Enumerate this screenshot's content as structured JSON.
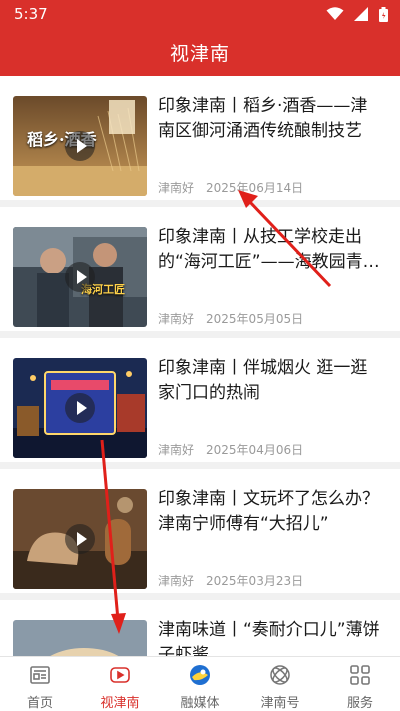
{
  "status": {
    "time": "5:37"
  },
  "header": {
    "title": "视津南"
  },
  "articles": [
    {
      "title": "印象津南丨稻乡·酒香——津南区御河涌酒传统酿制技艺",
      "source": "津南好",
      "date": "2025年06月14日",
      "thumb_caption": "稻乡·酒香"
    },
    {
      "title": "印象津南丨从技工学校走出的“海河工匠”——海教园青…",
      "source": "津南好",
      "date": "2025年05月05日",
      "thumb_caption": "海河工匠"
    },
    {
      "title": "印象津南丨伴城烟火 逛一逛家门口的热闹",
      "source": "津南好",
      "date": "2025年04月06日"
    },
    {
      "title": "印象津南丨文玩坏了怎么办？津南宁师傅有“大招儿”",
      "source": "津南好",
      "date": "2025年03月23日"
    },
    {
      "title": "津南味道丨“奏耐介口儿”薄饼子虾酱",
      "source": "",
      "date": ""
    }
  ],
  "tabbar": {
    "items": [
      {
        "label": "首页",
        "icon": "newspaper-icon",
        "active": false
      },
      {
        "label": "视津南",
        "icon": "video-icon",
        "active": true
      },
      {
        "label": "融媒体",
        "icon": "media-globe-icon",
        "active": false
      },
      {
        "label": "津南号",
        "icon": "orbit-icon",
        "active": false
      },
      {
        "label": "服务",
        "icon": "grid-icon",
        "active": false
      }
    ]
  },
  "colors": {
    "brand": "#d9302b",
    "meta": "#9a9a9a",
    "annotation": "#e0201a"
  }
}
